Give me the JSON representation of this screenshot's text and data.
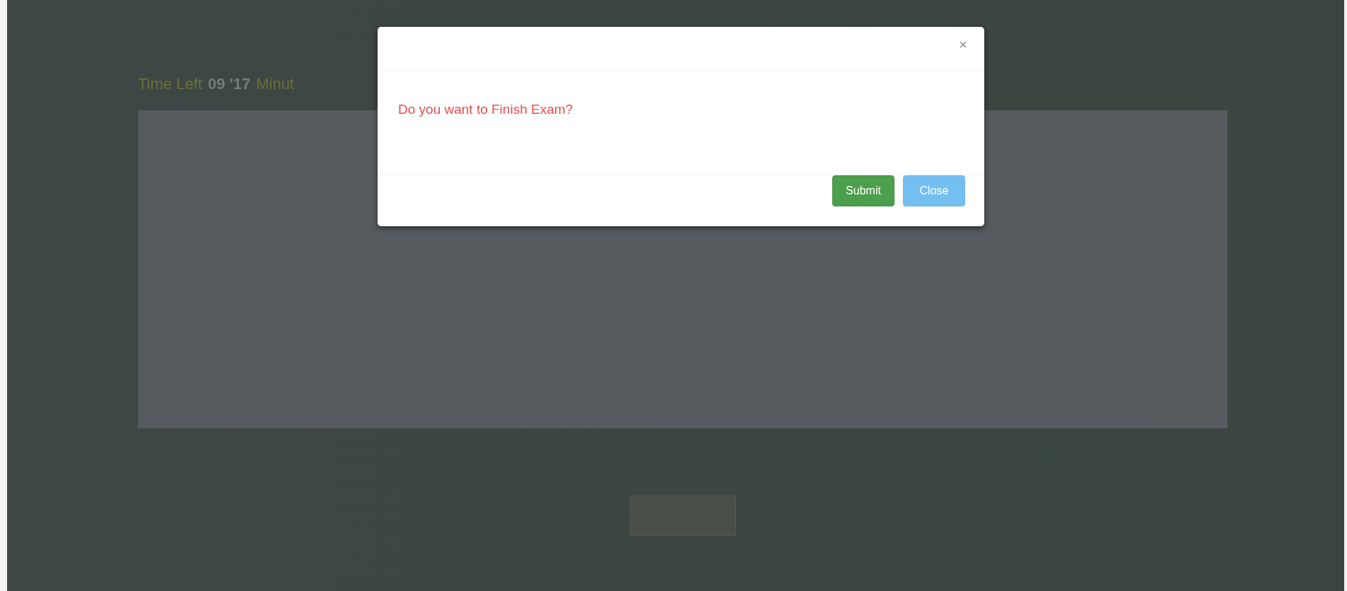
{
  "timer": {
    "label": "Time Left",
    "value": "09 '17",
    "unit": "Minut"
  },
  "dialog": {
    "message": "Do you want to Finish Exam?",
    "close_symbol": "×",
    "buttons": [
      {
        "label": "Submit",
        "kind": "primary"
      },
      {
        "label": "Close",
        "kind": "secondary"
      }
    ]
  }
}
